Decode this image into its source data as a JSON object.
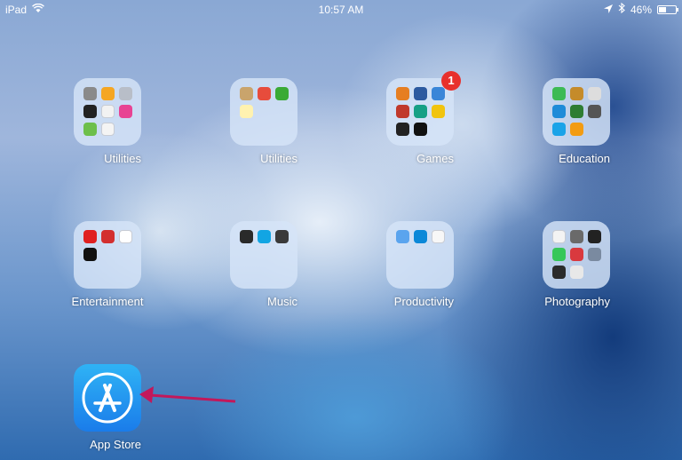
{
  "status_bar": {
    "device": "iPad",
    "time": "10:57 AM",
    "battery": "46%",
    "battery_level": 0.46,
    "icons": [
      "wifi-icon",
      "location-icon",
      "bluetooth-icon",
      "battery-icon"
    ]
  },
  "folders": [
    {
      "name": "Utilities",
      "apps": [
        "#8a8a8a",
        "#f5a623",
        "#b8bec8",
        "#222222",
        "#f2f2f2",
        "#e84393",
        "#6dbf4b",
        "#f4f4f4"
      ]
    },
    {
      "name": "Utilities",
      "apps": [
        "#c9a46c",
        "#e74c3c",
        "#3aaa35",
        "#fff2b0"
      ]
    },
    {
      "name": "Games",
      "badge": "1",
      "apps": [
        "#e67e22",
        "#2c5aa0",
        "#3a86d8",
        "#c0392b",
        "#16a085",
        "#f1c40f",
        "#222222",
        "#111111"
      ]
    },
    {
      "name": "Education",
      "apps": [
        "#3cba54",
        "#c58b2a",
        "#dddddd",
        "#1e8bd8",
        "#2e7d32",
        "#555555",
        "#1aa3e8",
        "#f39c12"
      ]
    },
    {
      "name": "Entertainment",
      "apps": [
        "#e02020",
        "#d32f2f",
        "#ffffff",
        "#111111"
      ]
    },
    {
      "name": "Music",
      "apps": [
        "#2a2a2a",
        "#12a5e3",
        "#3a3a3a"
      ]
    },
    {
      "name": "Productivity",
      "apps": [
        "#5aa4ee",
        "#0b88d8",
        "#f7f7f7"
      ]
    },
    {
      "name": "Photography",
      "apps": [
        "#f3f3f3",
        "#6a6a6a",
        "#222222",
        "#35c759",
        "#d9393e",
        "#7a8aa0",
        "#2b2b2b",
        "#e8e8e8"
      ]
    }
  ],
  "app_store": {
    "label": "App Store"
  },
  "colors": {
    "arrow": "#c2185b",
    "badge": "#e8302c"
  }
}
